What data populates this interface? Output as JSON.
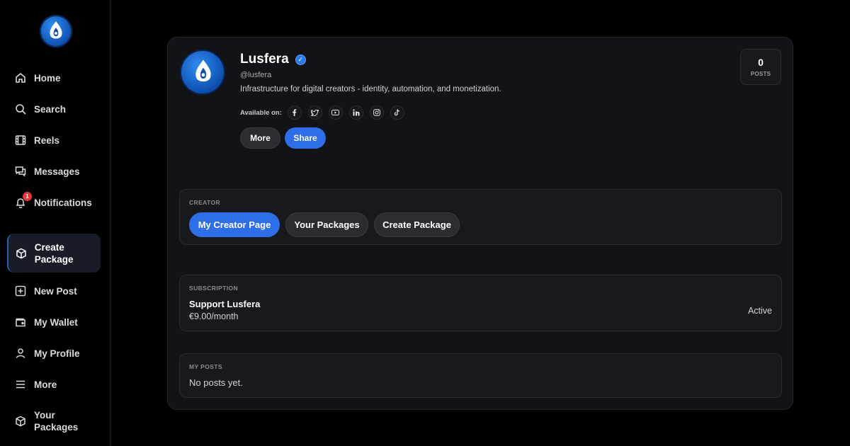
{
  "sidebar": {
    "items": [
      {
        "label": "Home",
        "icon": "home-icon"
      },
      {
        "label": "Search",
        "icon": "search-icon"
      },
      {
        "label": "Reels",
        "icon": "film-icon"
      },
      {
        "label": "Messages",
        "icon": "chat-icon"
      },
      {
        "label": "Notifications",
        "icon": "bell-icon",
        "badge": "1"
      },
      {
        "label": "Create Package",
        "icon": "package-icon",
        "active": true
      },
      {
        "label": "New Post",
        "icon": "plus-square-icon"
      },
      {
        "label": "My Wallet",
        "icon": "wallet-icon"
      },
      {
        "label": "My Profile",
        "icon": "user-icon"
      },
      {
        "label": "More",
        "icon": "menu-icon"
      },
      {
        "label": "Your Packages",
        "icon": "package-icon"
      }
    ]
  },
  "profile": {
    "name": "Lusfera",
    "verified_mark": "✓",
    "handle": "@lusfera",
    "bio": "Infrastructure for digital creators - identity, automation, and monetization.",
    "available_label": "Available on:",
    "socials": [
      "facebook-icon",
      "twitter-icon",
      "youtube-icon",
      "linkedin-icon",
      "instagram-icon",
      "tiktok-icon"
    ],
    "more_label": "More",
    "share_label": "Share",
    "posts_count": "0",
    "posts_label": "POSTS"
  },
  "creator": {
    "title": "CREATOR",
    "buttons": [
      "My Creator Page",
      "Your Packages",
      "Create Package"
    ]
  },
  "subscription": {
    "title": "SUBSCRIPTION",
    "name": "Support Lusfera",
    "price": "€9.00/month",
    "status": "Active"
  },
  "my_posts": {
    "title": "MY POSTS",
    "empty_text": "No posts yet."
  },
  "colors": {
    "accent": "#2e6ee8",
    "card_bg": "#111316",
    "section_bg": "#17191d",
    "badge": "#e5383b"
  }
}
